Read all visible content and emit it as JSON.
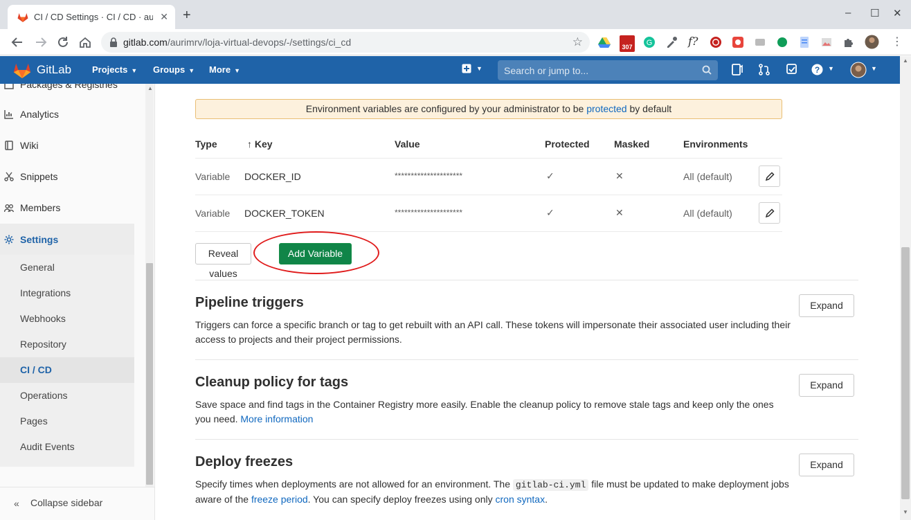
{
  "browser": {
    "tab_title": "CI / CD Settings · CI / CD · aurimrv / loja-virtual-devops",
    "tab_close_icon": "✕",
    "new_tab_icon": "+",
    "url_host": "gitlab.com",
    "url_path": "/aurimrv/loja-virtual-devops/-/settings/ci_cd",
    "gmail_badge": "307",
    "window_controls": [
      "–",
      "☐",
      "✕"
    ]
  },
  "header": {
    "brand": "GitLab",
    "menus": [
      {
        "label": "Projects"
      },
      {
        "label": "Groups"
      },
      {
        "label": "More"
      }
    ],
    "search_placeholder": "Search or jump to..."
  },
  "sidebar": {
    "items": [
      {
        "label": "Packages & Registries",
        "icon": "package-icon"
      },
      {
        "label": "Analytics",
        "icon": "chart-icon"
      },
      {
        "label": "Wiki",
        "icon": "book-icon"
      },
      {
        "label": "Snippets",
        "icon": "scissors-icon"
      },
      {
        "label": "Members",
        "icon": "users-icon"
      },
      {
        "label": "Settings",
        "icon": "gear-icon"
      }
    ],
    "settings_sub": [
      "General",
      "Integrations",
      "Webhooks",
      "Repository",
      "CI / CD",
      "Operations",
      "Pages",
      "Audit Events"
    ],
    "collapse_label": "Collapse sidebar"
  },
  "variables": {
    "alert_prefix": "Environment variables are configured by your administrator to be ",
    "alert_link": "protected",
    "alert_suffix": " by default",
    "columns": {
      "type": "Type",
      "key": "↑ Key",
      "value": "Value",
      "protected": "Protected",
      "masked": "Masked",
      "environments": "Environments"
    },
    "rows": [
      {
        "type": "Variable",
        "key": "DOCKER_ID",
        "value": "*********************",
        "protected": "✓",
        "masked": "✕",
        "environments": "All (default)"
      },
      {
        "type": "Variable",
        "key": "DOCKER_TOKEN",
        "value": "*********************",
        "protected": "✓",
        "masked": "✕",
        "environments": "All (default)"
      }
    ],
    "reveal_button": "Reveal values",
    "add_button": "Add Variable"
  },
  "sections": [
    {
      "title": "Pipeline triggers",
      "desc": "Triggers can force a specific branch or tag to get rebuilt with an API call. These tokens will impersonate their associated user including their access to projects and their project permissions.",
      "expand": "Expand"
    },
    {
      "title": "Cleanup policy for tags",
      "desc": "Save space and find tags in the Container Registry more easily. Enable the cleanup policy to remove stale tags and keep only the ones you need. ",
      "link": "More information",
      "expand": "Expand"
    },
    {
      "title": "Deploy freezes",
      "desc_a": "Specify times when deployments are not allowed for an environment. The ",
      "code": "gitlab-ci.yml",
      "desc_b": " file must be updated to make deployment jobs aware of the ",
      "link1": "freeze period",
      "desc_c": ". You can specify deploy freezes using only ",
      "link2": "cron syntax",
      "desc_d": ".",
      "expand": "Expand"
    }
  ],
  "colors": {
    "header_blue": "#1f63a8",
    "green_button": "#108548",
    "annotation_red": "#e01b1b",
    "link_blue": "#1068bf"
  }
}
